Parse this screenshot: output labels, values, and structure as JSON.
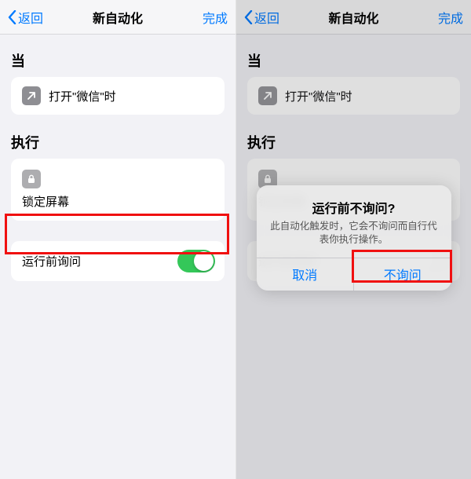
{
  "colors": {
    "accent": "#007aff",
    "switch_on": "#34c759",
    "highlight": "#f01010",
    "bg": "#f2f2f6"
  },
  "nav": {
    "back_label": "返回",
    "title": "新自动化",
    "done_label": "完成"
  },
  "sections": {
    "when_header": "当",
    "do_header": "执行"
  },
  "when_card": {
    "icon": "open-app-icon",
    "label": "打开\"微信\"时"
  },
  "do_card": {
    "icon": "lock-icon",
    "label": "锁定屏幕"
  },
  "toggle": {
    "label": "运行前询问",
    "left_state": "on",
    "right_state": "off"
  },
  "alert": {
    "title": "运行前不询问?",
    "message": "此自动化触发时，它会不询问而自行代表你执行操作。",
    "cancel": "取消",
    "confirm": "不询问"
  }
}
